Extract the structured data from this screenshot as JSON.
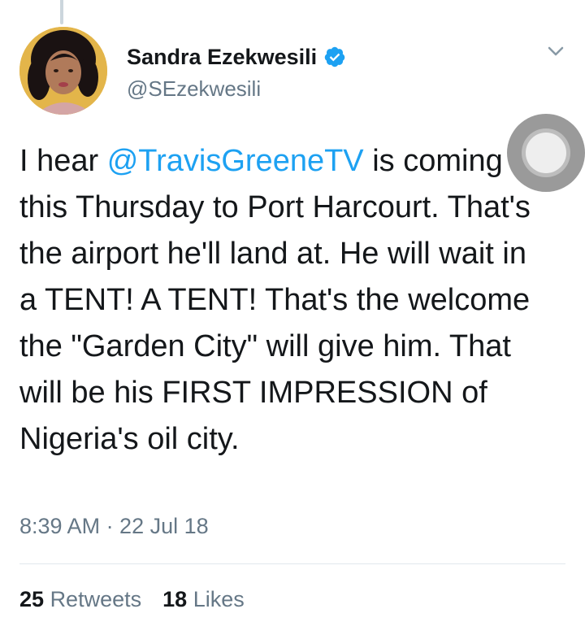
{
  "tweet": {
    "author": {
      "display_name": "Sandra Ezekwesili",
      "handle": "@SEzekwesili",
      "verified": true
    },
    "text_parts": {
      "before_mention": "I hear ",
      "mention": "@TravisGreeneTV",
      "after_mention": " is coming this Thursday to Port Harcourt. That's the airport he'll land at. He will wait in a TENT! A TENT! That's the welcome the \"Garden City\" will give him. That will be his FIRST IMPRESSION of Nigeria's oil city."
    },
    "timestamp": "8:39 AM · 22 Jul 18",
    "stats": {
      "retweets_count": "25",
      "retweets_label": "Retweets",
      "likes_count": "18",
      "likes_label": "Likes"
    }
  },
  "colors": {
    "accent": "#1da1f2",
    "secondary_text": "#657786",
    "primary_text": "#14171a",
    "divider": "#e1e8ed"
  },
  "icons": {
    "verified": "verified-badge-icon",
    "menu": "chevron-down-icon",
    "overlay": "assistive-touch-icon"
  }
}
